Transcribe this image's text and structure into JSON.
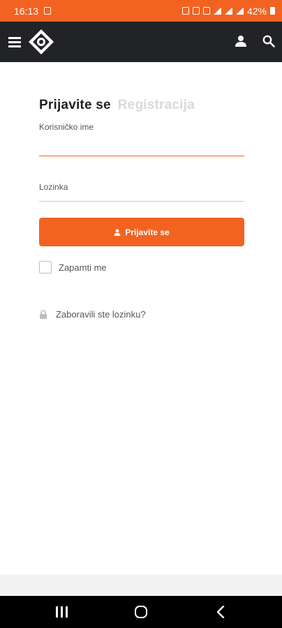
{
  "status_bar": {
    "time": "16:13",
    "battery": "42%"
  },
  "header": {
    "menu_icon": "hamburger-menu-icon",
    "logo": "brand-logo",
    "user_icon": "user-icon",
    "search_icon": "search-icon"
  },
  "login_form": {
    "tab_login": "Prijavite se",
    "tab_register": "Registracija",
    "username_label": "Korisničko ime",
    "username_value": "",
    "password_label": "Lozinka",
    "password_value": "",
    "submit_label": "Prijavite se",
    "remember_label": "Zapamti me",
    "remember_checked": false,
    "forgot_label": "Zaboravili ste lozinku?"
  },
  "colors": {
    "accent": "#f26322",
    "header_bg": "#222326",
    "muted_tab": "#d8d8d8"
  },
  "nav_bar": {
    "recent_icon": "recent-apps-icon",
    "home_icon": "home-icon",
    "back_icon": "back-icon"
  }
}
